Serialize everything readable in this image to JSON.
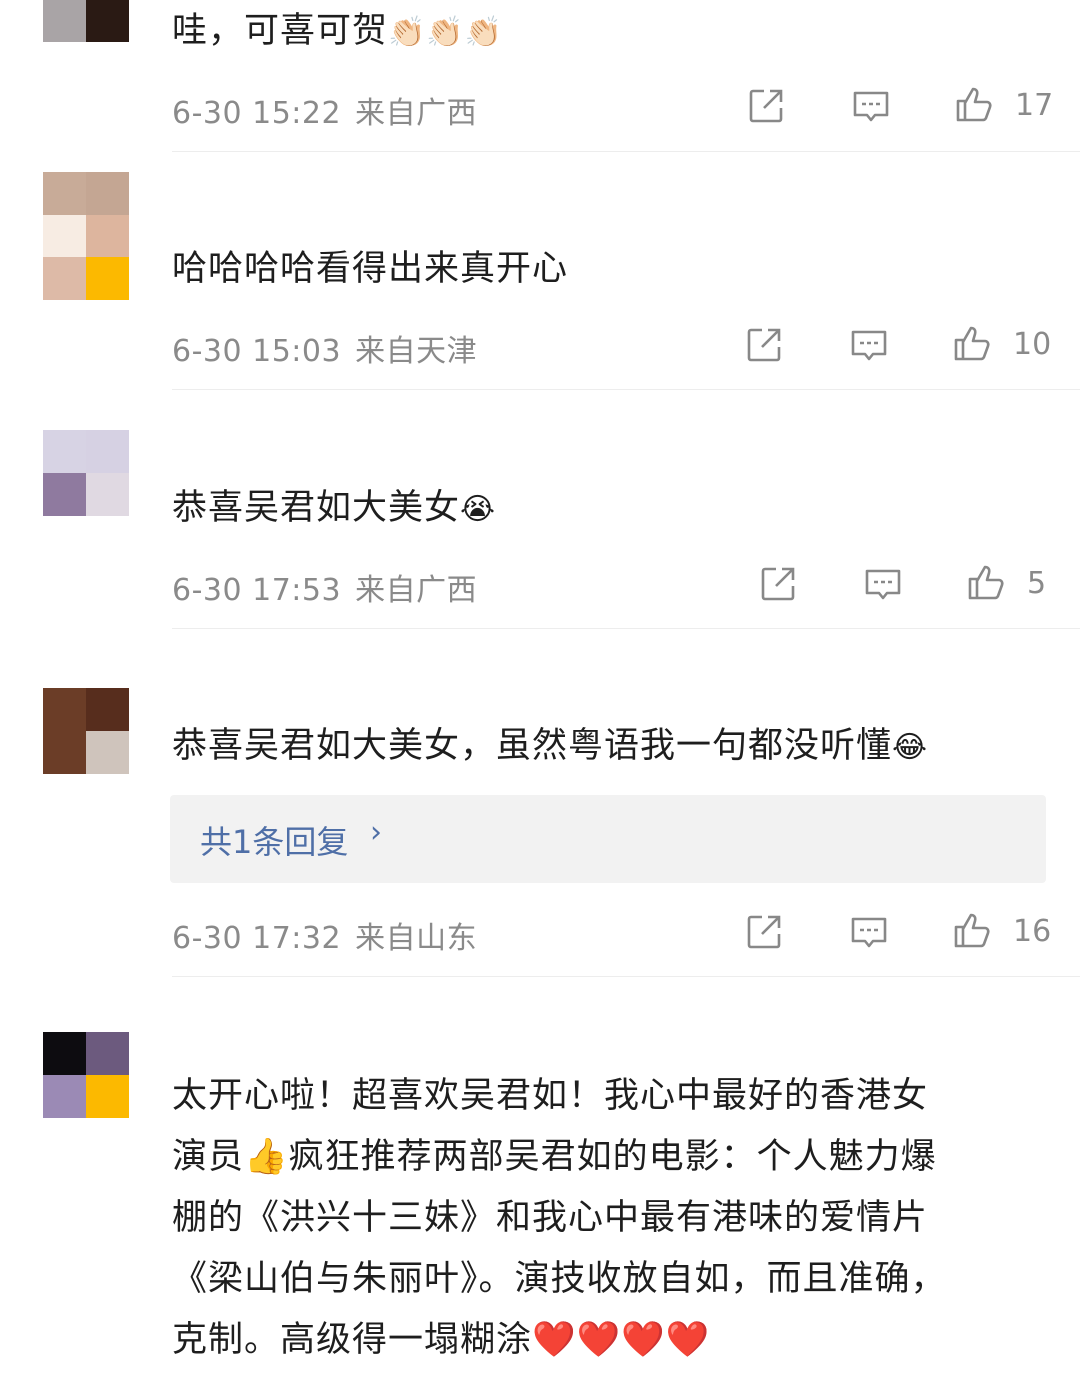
{
  "comments": [
    {
      "text": "哇，可喜可贺",
      "emoji": "👏🏻👏🏻👏🏻",
      "date": "6-30 15:22",
      "location": "来自广西",
      "likes": "17"
    },
    {
      "text": "哈哈哈哈看得出来真开心",
      "emoji": "",
      "date": "6-30 15:03",
      "location": "来自天津",
      "likes": "10"
    },
    {
      "text": "恭喜吴君如大美女",
      "emoji": "😭",
      "date": "6-30 17:53",
      "location": "来自广西",
      "likes": "5"
    },
    {
      "text": "恭喜吴君如大美女，虽然粤语我一句都没听懂",
      "emoji": "😂",
      "reply_label": "共1条回复",
      "reply_chevron": "›",
      "date": "6-30 17:32",
      "location": "来自山东",
      "likes": "16"
    },
    {
      "text_lines": [
        "太开心啦！超喜欢吴君如！我心中最好的香港女",
        "演员👍疯狂推荐两部吴君如的电影：个人魅力爆",
        "棚的《洪兴十三妹》和我心中最有港味的爱情片",
        "《梁山伯与朱丽叶》。演技收放自如，而且准确，",
        "克制。高级得一塌糊涂❤️❤️❤️❤️"
      ]
    }
  ],
  "icons": {
    "share": "share-icon",
    "comment": "comment-icon",
    "like": "thumbs-up-icon"
  },
  "colors": {
    "meta_gray": "#8a8a8a",
    "reply_link_blue": "#4f6fa7",
    "reply_bg": "#f2f2f2"
  }
}
